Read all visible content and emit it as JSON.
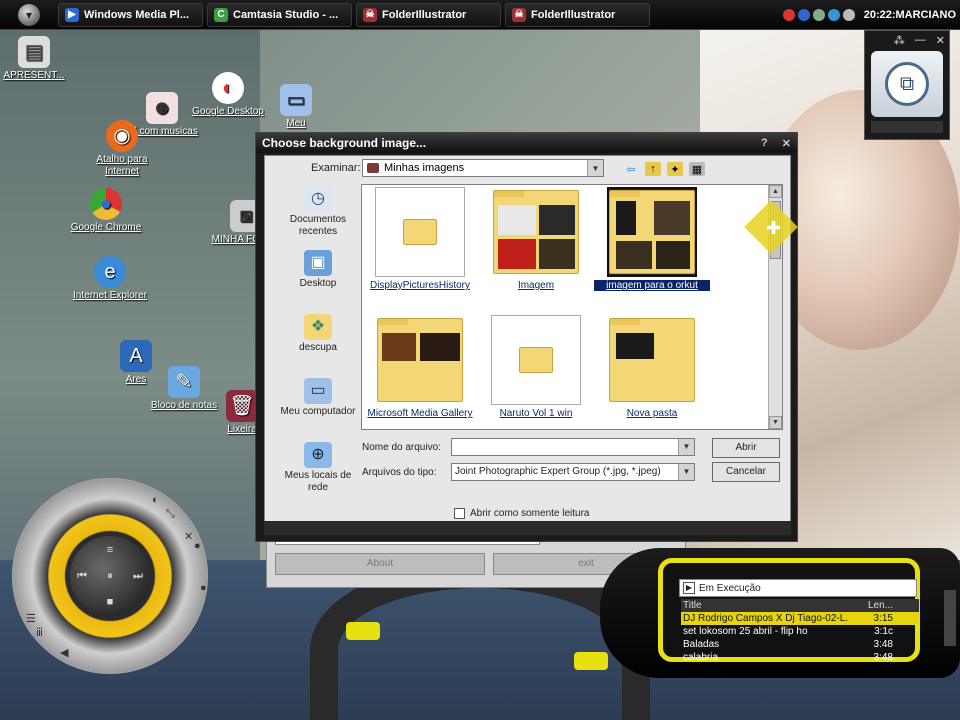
{
  "taskbar": {
    "tasks": [
      {
        "label": "Windows Media Pl...",
        "icon": "media-player-icon",
        "color": "#2a6ad0"
      },
      {
        "label": "Camtasia Studio - ...",
        "icon": "camtasia-icon",
        "color": "#3aa040"
      },
      {
        "label": "FolderIllustrator",
        "icon": "skull-icon",
        "color": "#a03030"
      },
      {
        "label": "FolderIllustrator",
        "icon": "skull-icon",
        "color": "#a03030"
      }
    ],
    "clock": "20:22:MARCIANO"
  },
  "desktop_icons": [
    {
      "label": "APRESENT...",
      "icon": "document-icon"
    },
    {
      "label": "Google Desktop",
      "icon": "google-desktop-icon"
    },
    {
      "label": "cd com musicas",
      "icon": "figure-icon"
    },
    {
      "label": "Meu",
      "icon": "computer-icon"
    },
    {
      "label": "Atalho para Internet",
      "icon": "firefox-icon"
    },
    {
      "label": "Google Chrome",
      "icon": "chrome-icon"
    },
    {
      "label": "MINHA FOTOS",
      "icon": "camera-icon"
    },
    {
      "label": "Internet Explorer",
      "icon": "ie-icon"
    },
    {
      "label": "Ares",
      "icon": "ares-icon"
    },
    {
      "label": "Bloco de notas",
      "icon": "notepad-icon"
    },
    {
      "label": "Lixeira",
      "icon": "trash-icon"
    }
  ],
  "back_panel": {
    "buttons": [
      "About",
      "exit"
    ]
  },
  "dialog": {
    "title": "Choose background image...",
    "look_in_label": "Examinar:",
    "look_in_value": "Minhas imagens",
    "places": [
      {
        "label": "Documentos recentes",
        "icon": "recent-documents-icon"
      },
      {
        "label": "Desktop",
        "icon": "desktop-icon"
      },
      {
        "label": "descupa",
        "icon": "user-folder-icon"
      },
      {
        "label": "Meu computador",
        "icon": "my-computer-icon"
      },
      {
        "label": "Meus locais de rede",
        "icon": "network-icon"
      }
    ],
    "files": [
      {
        "name": "DisplayPicturesHistory",
        "type": "plain-folder"
      },
      {
        "name": "Imagem",
        "type": "photo-folder"
      },
      {
        "name": "imagem para o orkut",
        "type": "photo-folder",
        "selected": true
      },
      {
        "name": "Microsoft Media Gallery",
        "type": "photo-folder"
      },
      {
        "name": "Naruto Vol 1 win",
        "type": "plain-folder"
      },
      {
        "name": "Nova pasta",
        "type": "photo-folder"
      }
    ],
    "filename_label": "Nome do arquivo:",
    "filename_value": "",
    "filetype_label": "Arquivos do tipo:",
    "filetype_value": "Joint Photographic Expert Group (*.jpg, *.jpeg)",
    "readonly_label": "Abrir como somente leitura",
    "open_button": "Abrir",
    "cancel_button": "Cancelar"
  },
  "now_playing": {
    "header": "Em Execução",
    "columns": [
      "Title",
      "Len..."
    ],
    "tracks": [
      {
        "title": "DJ Rodrigo Campos X Dj Tiago-02-L...",
        "length": "3:15",
        "active": true
      },
      {
        "title": "set lokosom 25 abril - flip ho",
        "length": "3:1c",
        "active": false
      },
      {
        "title": "Baladas",
        "length": "3:48",
        "active": false
      },
      {
        "title": "calabria",
        "length": "3:48",
        "active": false
      }
    ]
  },
  "colors": {
    "accent_yellow": "#e9e10f",
    "folder": "#f3d776",
    "selection": "#0a246a"
  }
}
